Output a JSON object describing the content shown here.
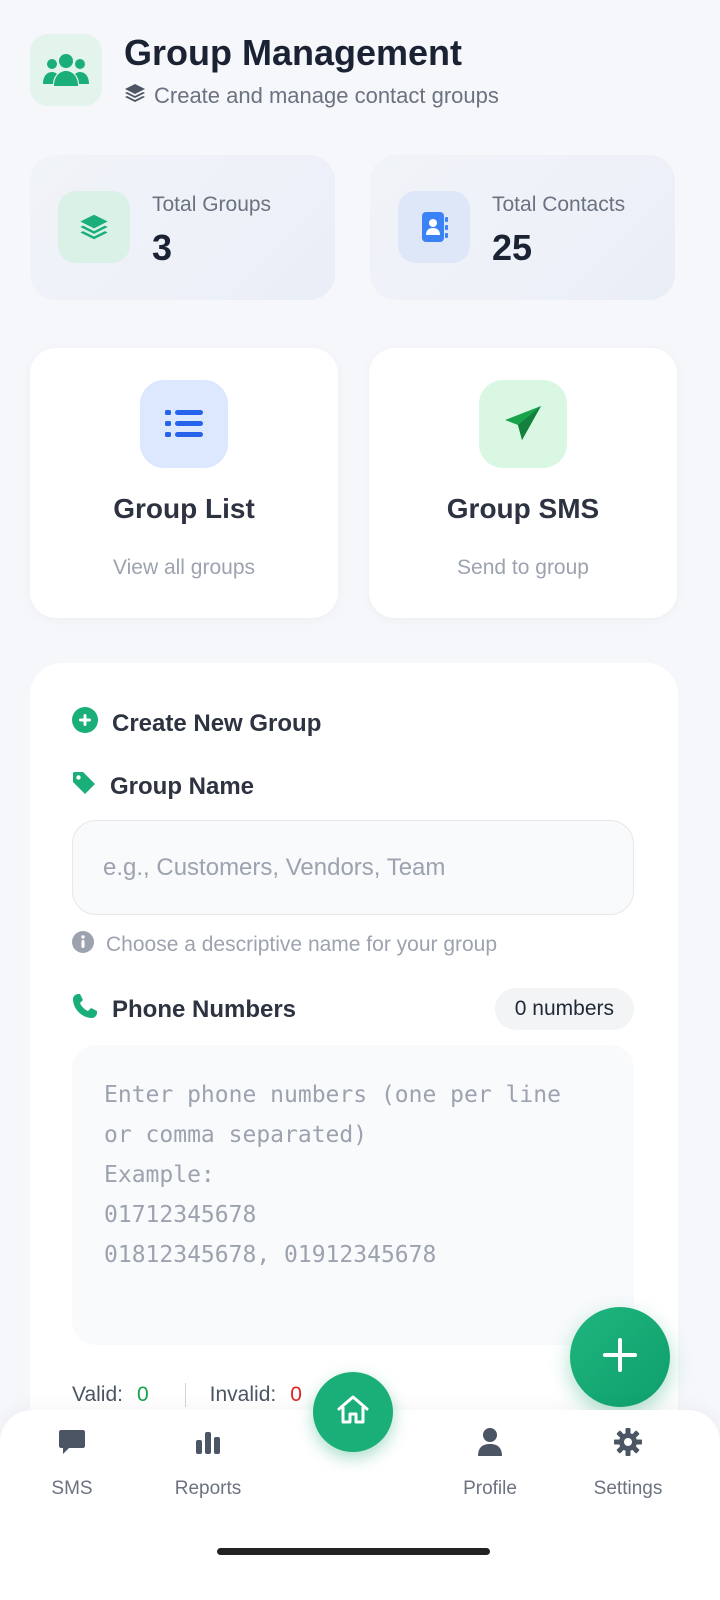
{
  "header": {
    "title": "Group Management",
    "subtitle": "Create and manage contact groups"
  },
  "stats": [
    {
      "label": "Total Groups",
      "value": "3"
    },
    {
      "label": "Total Contacts",
      "value": "25"
    }
  ],
  "actions": [
    {
      "title": "Group List",
      "subtitle": "View all groups"
    },
    {
      "title": "Group SMS",
      "subtitle": "Send to group"
    }
  ],
  "form": {
    "section_title": "Create New Group",
    "name_label": "Group Name",
    "name_value": "",
    "name_placeholder": "e.g., Customers, Vendors, Team",
    "name_hint": "Choose a descriptive name for your group",
    "phone_label": "Phone Numbers",
    "phone_count": "0 numbers",
    "phone_value": "",
    "phone_placeholder": "Enter phone numbers (one per line or comma separated)\nExample:\n01712345678\n01812345678, 01912345678",
    "valid_label": "Valid:",
    "valid_count": "0",
    "invalid_label": "Invalid:",
    "invalid_count": "0"
  },
  "nav": {
    "items": [
      {
        "label": "SMS",
        "icon": "chat-icon"
      },
      {
        "label": "Reports",
        "icon": "bar-chart-icon"
      },
      {
        "label": "",
        "icon": "home-icon"
      },
      {
        "label": "Profile",
        "icon": "user-icon"
      },
      {
        "label": "Settings",
        "icon": "gear-icon"
      }
    ]
  },
  "colors": {
    "accent": "#1aae78",
    "blue": "#2563eb",
    "valid": "#16a34a",
    "invalid": "#dc2626"
  }
}
